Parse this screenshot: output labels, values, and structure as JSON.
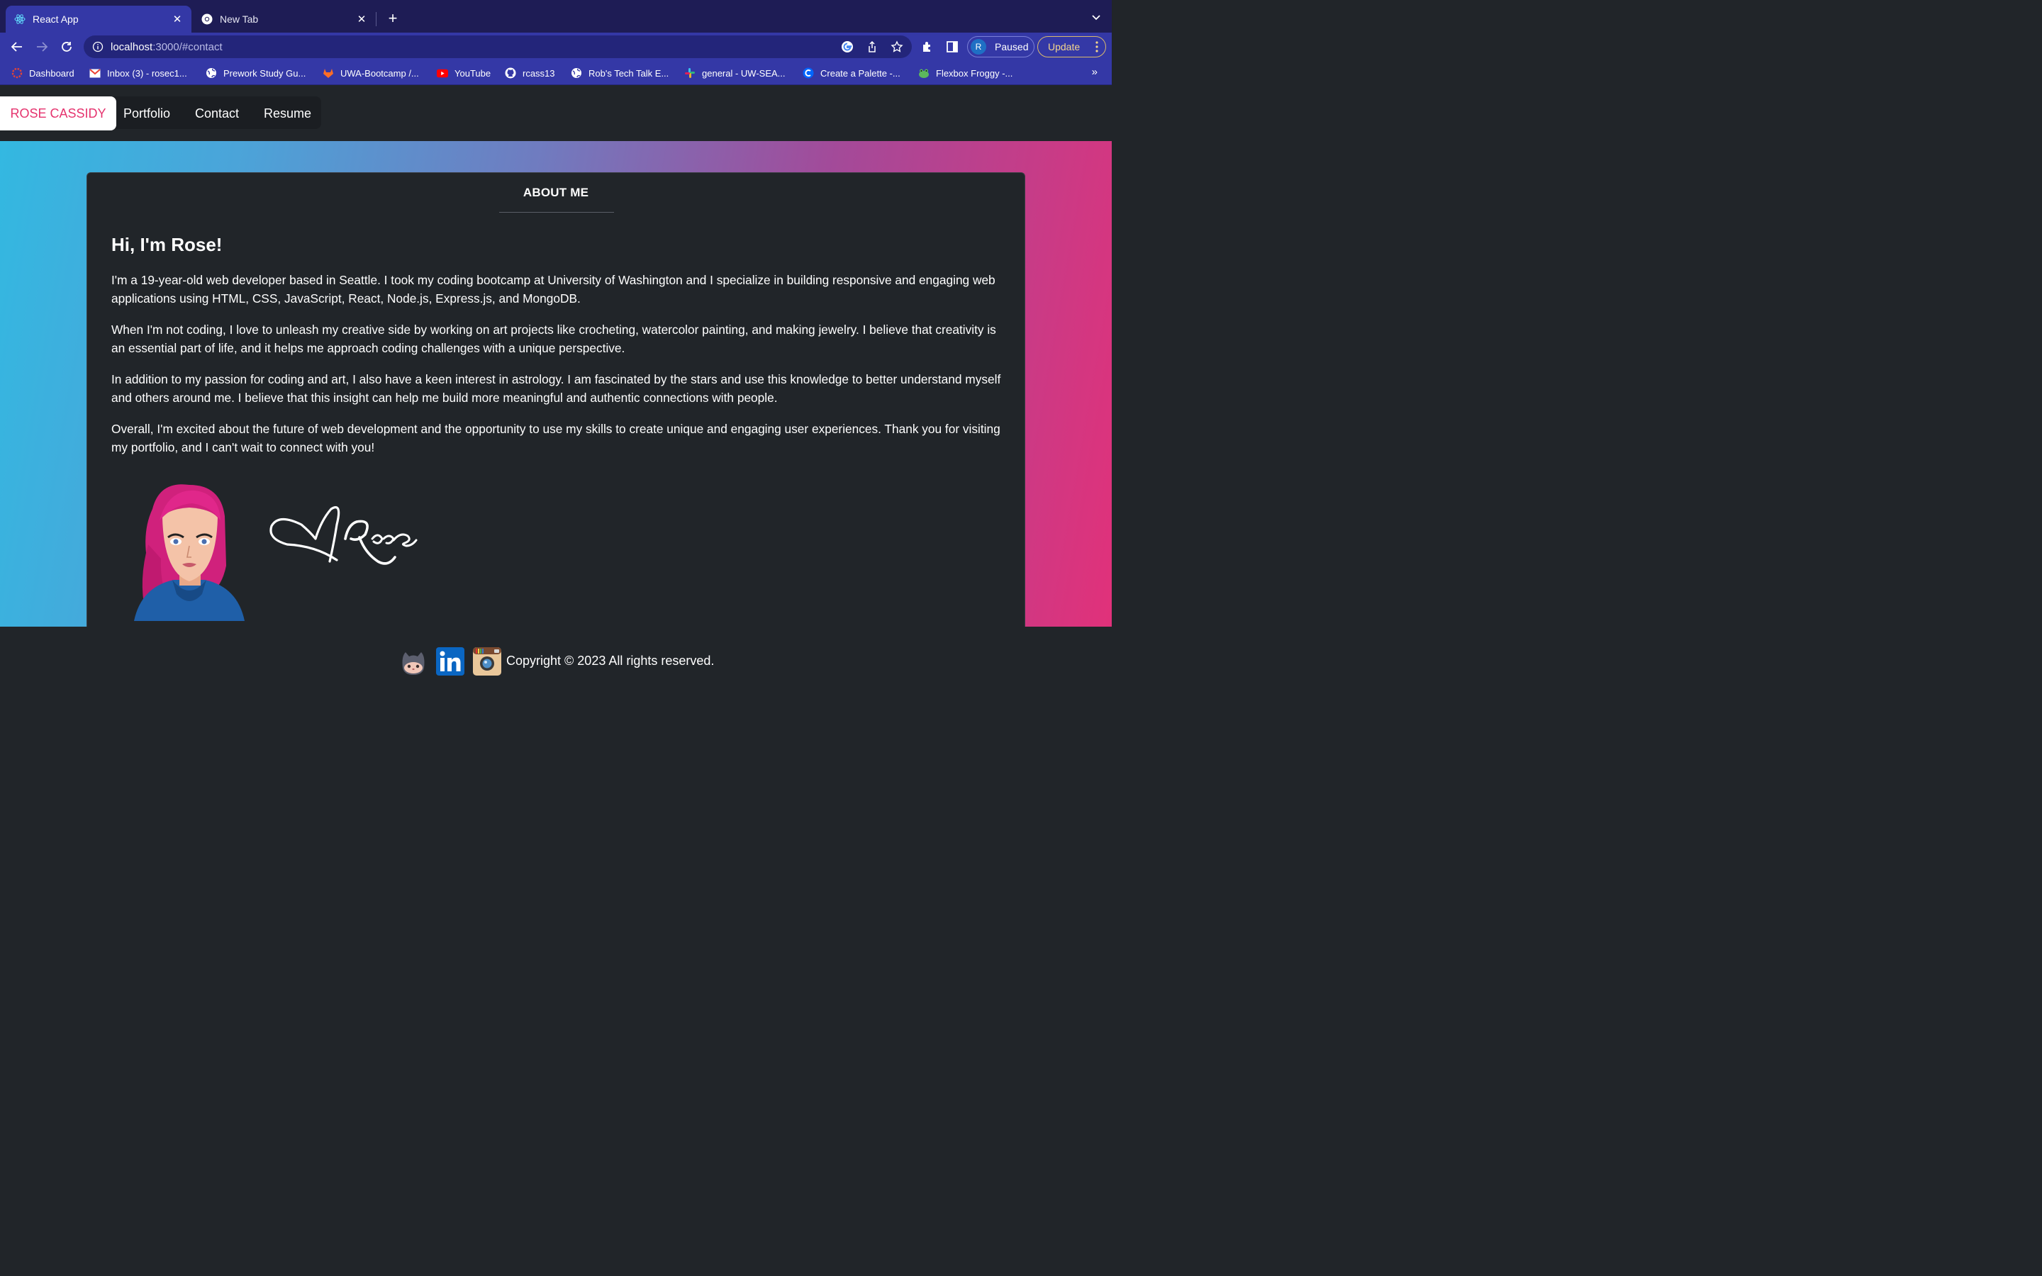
{
  "browser": {
    "tabs": [
      {
        "title": "React App",
        "icon": "react-icon",
        "active": true
      },
      {
        "title": "New Tab",
        "icon": "chrome-icon",
        "active": false
      }
    ],
    "url_host": "localhost",
    "url_rest": ":3000/#contact",
    "profile": {
      "initial": "R",
      "label": "Paused"
    },
    "update_label": "Update",
    "bookmarks": [
      {
        "label": "Dashboard",
        "icon": "canvas-icon"
      },
      {
        "label": "Inbox (3) - rosec1...",
        "icon": "gmail-icon"
      },
      {
        "label": "Prework Study Gu...",
        "icon": "globe-icon"
      },
      {
        "label": "UWA-Bootcamp /...",
        "icon": "gitlab-icon"
      },
      {
        "label": "YouTube",
        "icon": "youtube-icon"
      },
      {
        "label": "rcass13",
        "icon": "github-icon"
      },
      {
        "label": "Rob's Tech Talk E...",
        "icon": "globe-icon"
      },
      {
        "label": "general - UW-SEA...",
        "icon": "slack-icon"
      },
      {
        "label": "Create a Palette -...",
        "icon": "coolors-icon"
      },
      {
        "label": "Flexbox Froggy -...",
        "icon": "frog-icon"
      }
    ],
    "more_bookmarks": "»"
  },
  "nav": {
    "brand": "ROSE CASSIDY",
    "links": [
      "Portfolio",
      "Contact",
      "Resume"
    ]
  },
  "about": {
    "title": "ABOUT ME",
    "greeting": "Hi, I'm Rose!",
    "paragraphs": [
      "I'm a 19-year-old web developer based in Seattle. I took my coding bootcamp at University of Washington and I specialize in building responsive and engaging web applications using HTML, CSS, JavaScript, React, Node.js, Express.js, and MongoDB.",
      "When I'm not coding, I love to unleash my creative side by working on art projects like crocheting, watercolor painting, and making jewelry. I believe that creativity is an essential part of life, and it helps me approach coding challenges with a unique perspective.",
      "In addition to my passion for coding and art, I also have a keen interest in astrology. I am fascinated by the stars and use this knowledge to better understand myself and others around me. I believe that this insight can help me build more meaningful and authentic connections with people.",
      "Overall, I'm excited about the future of web development and the opportunity to use my skills to create unique and engaging user experiences. Thank you for visiting my portfolio, and I can't wait to connect with you!"
    ],
    "signature": "Rose"
  },
  "footer": {
    "social": [
      "github-icon",
      "linkedin-icon",
      "instagram-icon"
    ],
    "copyright": "Copyright © 2023 All rights reserved."
  },
  "colors": {
    "brand_pink": "#e5336e",
    "page_bg": "#212529",
    "chrome_blue": "#3438a6"
  }
}
